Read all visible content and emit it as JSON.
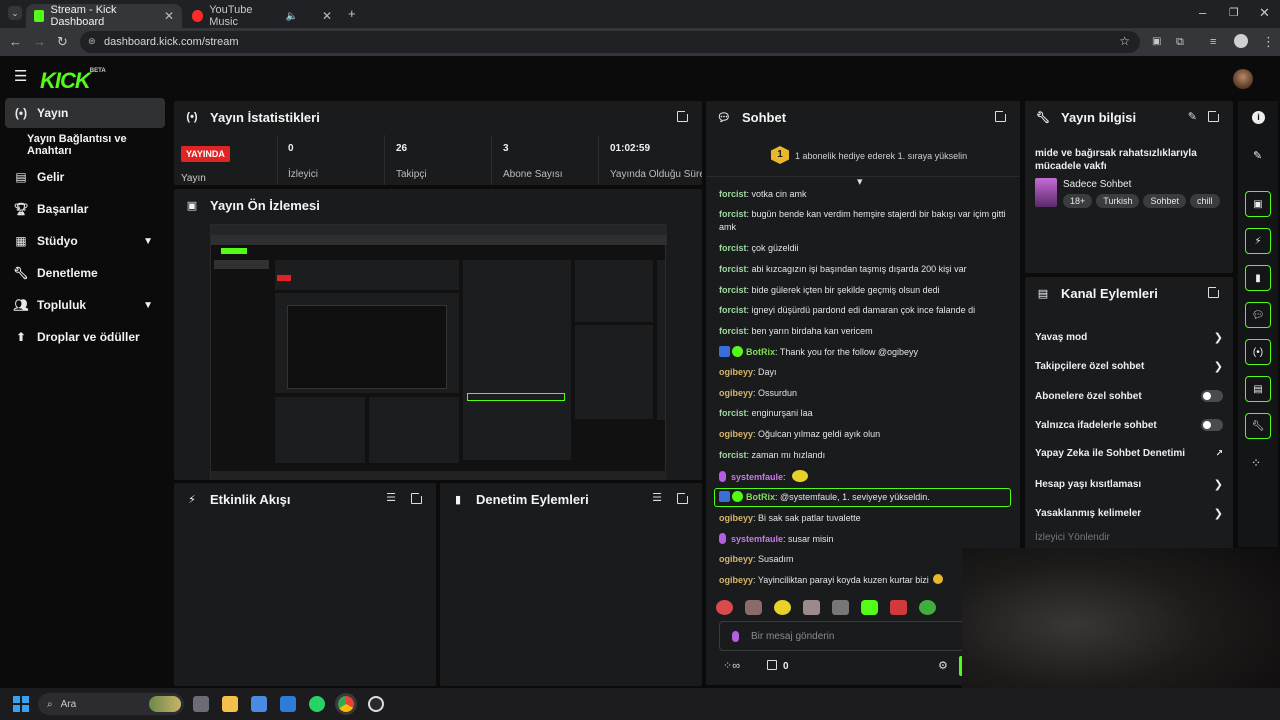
{
  "browser": {
    "tabs": [
      {
        "title": "Stream - Kick Dashboard"
      },
      {
        "title": "YouTube Music"
      }
    ],
    "url": "dashboard.kick.com/stream"
  },
  "app": {
    "logo": "KICK",
    "logo_tag": "BETA"
  },
  "sidebar": {
    "items": [
      {
        "label": "Yayın",
        "icon": "broadcast-icon"
      },
      {
        "label": "Yayın Bağlantısı ve Anahtarı"
      },
      {
        "label": "Gelir",
        "icon": "revenue-icon"
      },
      {
        "label": "Başarılar",
        "icon": "trophy-icon"
      },
      {
        "label": "Stüdyo",
        "icon": "studio-icon"
      },
      {
        "label": "Denetleme",
        "icon": "wrench-icon"
      },
      {
        "label": "Topluluk",
        "icon": "community-icon"
      },
      {
        "label": "Droplar ve ödüller",
        "icon": "drops-icon"
      }
    ]
  },
  "stats": {
    "title": "Yayın İstatistikleri",
    "status_badge": "YAYINDA",
    "status_label": "Yayın",
    "items": [
      {
        "value": "0",
        "label": "İzleyici"
      },
      {
        "value": "26",
        "label": "Takipçi"
      },
      {
        "value": "3",
        "label": "Abone Sayısı"
      },
      {
        "value": "01:02:59",
        "label": "Yayında Olduğu Süre"
      }
    ]
  },
  "preview": {
    "title": "Yayın Ön İzlemesi"
  },
  "activity": {
    "title": "Etkinlik Akışı"
  },
  "moderation": {
    "title": "Denetim Eylemleri"
  },
  "chat": {
    "title": "Sohbet",
    "pinned_rank": "1",
    "pinned_text": "1 abonelik hediye ederek 1. sıraya yükselin",
    "messages": [
      {
        "user": "forcist",
        "text": "votka cin amk",
        "type": "f"
      },
      {
        "user": "forcist",
        "text": "bugün bende kan verdim hemşire stajerdi bir bakışı var içim gitti amk",
        "type": "f"
      },
      {
        "user": "forcist",
        "text": "çok güzeldii",
        "type": "f"
      },
      {
        "user": "forcist",
        "text": "abi kızcagızın işi başından taşmış dışarda 200 kişi var",
        "type": "f"
      },
      {
        "user": "forcist",
        "text": "bide gülerek içten bir şekilde geçmiş olsun dedi",
        "type": "f"
      },
      {
        "user": "forcist",
        "text": "igneyi düşürdü pardond edi damaran çok ince falande di",
        "type": "f"
      },
      {
        "user": "forcist",
        "text": "ben yarın birdaha kan vericem",
        "type": "f"
      },
      {
        "user": "BotRix",
        "text": "Thank you for the follow @ogibeyy",
        "type": "b"
      },
      {
        "user": "ogibeyy",
        "text": "Dayı",
        "type": "o"
      },
      {
        "user": "ogibeyy",
        "text": "Ossurdun",
        "type": "o"
      },
      {
        "user": "forcist",
        "text": "enginurşani laa",
        "type": "f"
      },
      {
        "user": "ogibeyy",
        "text": "Oğulcan yılmaz geldi ayık olun",
        "type": "o"
      },
      {
        "user": "forcist",
        "text": "zaman mı hızlandı",
        "type": "f"
      },
      {
        "user": "systemfaule",
        "text": "",
        "type": "s"
      },
      {
        "user": "BotRix",
        "text": "@systemfaule, 1. seviyeye yükseldin.",
        "type": "b"
      },
      {
        "user": "ogibeyy",
        "text": "Bi sak sak patlar tuvalette",
        "type": "o"
      },
      {
        "user": "systemfaule",
        "text": "susar misin",
        "type": "s"
      },
      {
        "user": "ogibeyy",
        "text": "Susadım",
        "type": "o"
      },
      {
        "user": "ogibeyy",
        "text": "Yayinciliktan parayi koyda kuzen kurtar bizi",
        "type": "o"
      }
    ],
    "input_placeholder": "Bir mesaj gönderin",
    "points": "0"
  },
  "stream_info": {
    "title": "Yayın bilgisi",
    "stream_title": "mide ve bağırsak rahatsızlıklarıyla mücadele vakfı",
    "category": "Sadece Sohbet",
    "tags": [
      "18+",
      "Turkish",
      "Sohbet",
      "chill"
    ]
  },
  "channel_actions": {
    "title": "Kanal Eylemleri",
    "items": [
      {
        "label": "Yavaş mod",
        "control": "chevron"
      },
      {
        "label": "Takipçilere özel sohbet",
        "control": "chevron"
      },
      {
        "label": "Abonelere özel sohbet",
        "control": "toggle"
      },
      {
        "label": "Yalnızca ifadelerle sohbet",
        "control": "toggle"
      },
      {
        "label": "Yapay Zeka ile Sohbet Denetimi",
        "control": "external"
      },
      {
        "label": "Hesap yaşı kısıtlaması",
        "control": "chevron"
      },
      {
        "label": "Yasaklanmış kelimeler",
        "control": "chevron"
      },
      {
        "label": "İzleyici Yönlendir",
        "control": "none"
      }
    ]
  },
  "taskbar": {
    "search": "Ara"
  },
  "colors": {
    "brand": "#53fc18",
    "live": "#e02424",
    "bg": "#0b0b0c",
    "panel": "#1a1b1d"
  }
}
